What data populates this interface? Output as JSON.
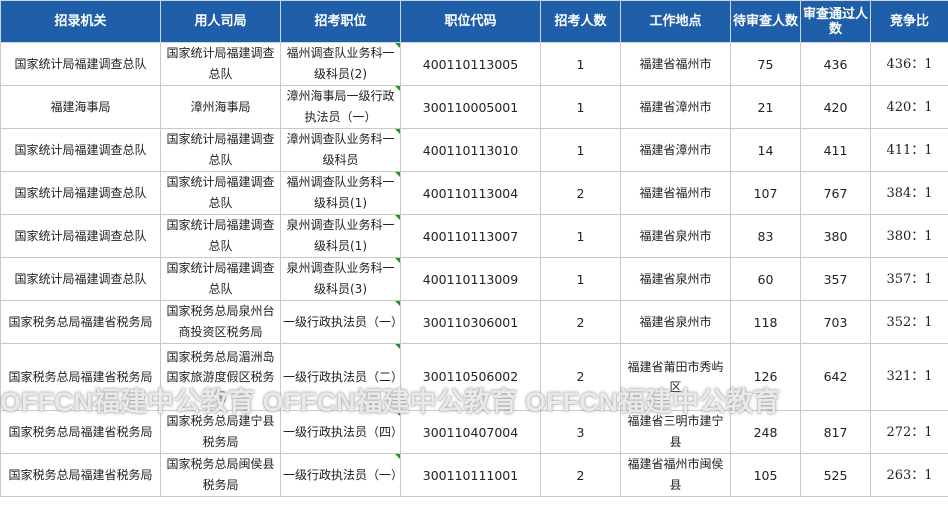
{
  "headers": [
    "招录机关",
    "用人司局",
    "招考职位",
    "职位代码",
    "招考人数",
    "工作地点",
    "待审查人数",
    "审查通过人数",
    "竞争比"
  ],
  "rows": [
    {
      "org": "国家统计局福建调查总队",
      "dept": "国家统计局福建调查总队",
      "position": "福州调查队业务科一级科员(2)",
      "code": "400110113005",
      "count": "1",
      "location": "福建省福州市",
      "pending": "75",
      "passed": "436",
      "ratio": "436：1"
    },
    {
      "org": "福建海事局",
      "dept": "漳州海事局",
      "position": "漳州海事局一级行政执法员（一）",
      "code": "300110005001",
      "count": "1",
      "location": "福建省漳州市",
      "pending": "21",
      "passed": "420",
      "ratio": "420：1"
    },
    {
      "org": "国家统计局福建调查总队",
      "dept": "国家统计局福建调查总队",
      "position": "漳州调查队业务科一级科员",
      "code": "400110113010",
      "count": "1",
      "location": "福建省漳州市",
      "pending": "14",
      "passed": "411",
      "ratio": "411：1"
    },
    {
      "org": "国家统计局福建调查总队",
      "dept": "国家统计局福建调查总队",
      "position": "福州调查队业务科一级科员(1)",
      "code": "400110113004",
      "count": "2",
      "location": "福建省福州市",
      "pending": "107",
      "passed": "767",
      "ratio": "384：1"
    },
    {
      "org": "国家统计局福建调查总队",
      "dept": "国家统计局福建调查总队",
      "position": "泉州调查队业务科一级科员(1)",
      "code": "400110113007",
      "count": "1",
      "location": "福建省泉州市",
      "pending": "83",
      "passed": "380",
      "ratio": "380：1"
    },
    {
      "org": "国家统计局福建调查总队",
      "dept": "国家统计局福建调查总队",
      "position": "泉州调查队业务科一级科员(3)",
      "code": "400110113009",
      "count": "1",
      "location": "福建省泉州市",
      "pending": "60",
      "passed": "357",
      "ratio": "357：1"
    },
    {
      "org": "国家税务总局福建省税务局",
      "dept": "国家税务总局泉州台商投资区税务局",
      "position": "一级行政执法员（一）",
      "code": "300110306001",
      "count": "2",
      "location": "福建省泉州市",
      "pending": "118",
      "passed": "703",
      "ratio": "352：1"
    },
    {
      "org": "国家税务总局福建省税务局",
      "dept": "国家税务总局湄洲岛国家旅游度假区税务局",
      "position": "一级行政执法员（二）",
      "code": "300110506002",
      "count": "2",
      "location": "福建省莆田市秀屿区",
      "pending": "126",
      "passed": "642",
      "ratio": "321：1"
    },
    {
      "org": "国家税务总局福建省税务局",
      "dept": "国家税务总局建宁县税务局",
      "position": "一级行政执法员（四）",
      "code": "300110407004",
      "count": "3",
      "location": "福建省三明市建宁县",
      "pending": "248",
      "passed": "817",
      "ratio": "272：1"
    },
    {
      "org": "国家税务总局福建省税务局",
      "dept": "国家税务总局闽侯县税务局",
      "position": "一级行政执法员（一）",
      "code": "300110111001",
      "count": "2",
      "location": "福建省福州市闽侯县",
      "pending": "105",
      "passed": "525",
      "ratio": "263：1"
    }
  ],
  "watermark": "OFFCN福建中公教育 OFFCN福建中公教育 OFFCN福建中公教育",
  "colors": {
    "header_bg": "#1f5ea8",
    "header_text": "#ffffff",
    "border": "#c9c9c9",
    "corner_mark": "#2e8b2e"
  }
}
